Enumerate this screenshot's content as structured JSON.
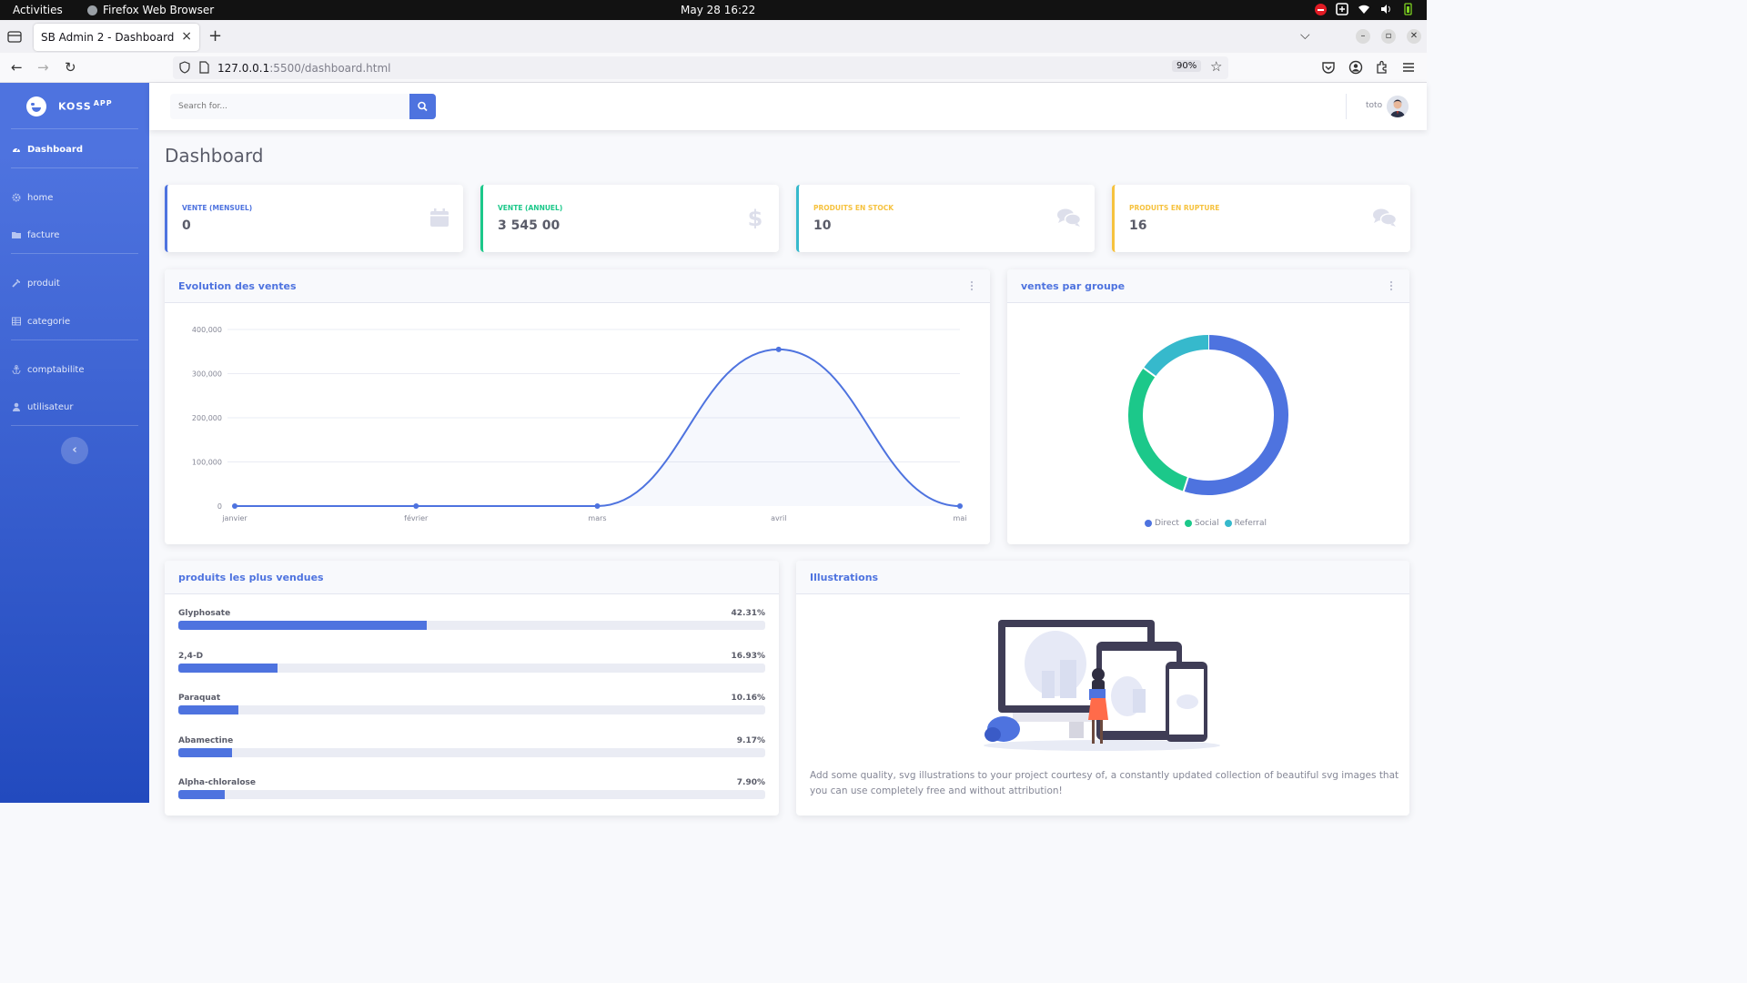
{
  "os": {
    "activities": "Activities",
    "app_name": "Firefox Web Browser",
    "clock": "May 28  16:22"
  },
  "browser": {
    "tab_title": "SB Admin 2 - Dashboard",
    "url_host": "127.0.0.1",
    "url_rest": ":5500/dashboard.html",
    "zoom": "90%"
  },
  "sidebar": {
    "brand": "KOSS",
    "brand_sup": "APP",
    "items": [
      {
        "label": "Dashboard",
        "icon": "dashboard-icon"
      },
      {
        "label": "home",
        "icon": "cog-icon"
      },
      {
        "label": "facture",
        "icon": "folder-icon"
      },
      {
        "label": "produit",
        "icon": "wrench-icon"
      },
      {
        "label": "categorie",
        "icon": "table-icon"
      },
      {
        "label": "comptabilite",
        "icon": "anchor-icon"
      },
      {
        "label": "utilisateur",
        "icon": "user-icon"
      }
    ]
  },
  "topbar": {
    "search_placeholder": "Search for...",
    "user_name": "toto"
  },
  "page": {
    "title": "Dashboard"
  },
  "stats": [
    {
      "label": "VENTE (MENSUEL)",
      "value": "0",
      "color": "#4e73df",
      "icon": "calendar-icon"
    },
    {
      "label": "VENTE (ANNUEL)",
      "value": "3 545 00",
      "color": "#1cc88a",
      "icon": "dollar-icon"
    },
    {
      "label": "PRODUITS EN STOCK",
      "value": "10",
      "color": "#f6c23e",
      "icon": "comments-icon"
    },
    {
      "label": "PRODUITS EN RUPTURE",
      "value": "16",
      "color": "#f6c23e",
      "icon": "comments-icon"
    }
  ],
  "area_card": {
    "title": "Evolution des ventes"
  },
  "pie_card": {
    "title": "ventes par groupe"
  },
  "products_card": {
    "title": "produits les plus vendues",
    "items": [
      {
        "name": "Glyphosate",
        "pct": "42.31%",
        "value": 42.31
      },
      {
        "name": "2,4-D",
        "pct": "16.93%",
        "value": 16.93
      },
      {
        "name": "Paraquat",
        "pct": "10.16%",
        "value": 10.16
      },
      {
        "name": "Abamectine",
        "pct": "9.17%",
        "value": 9.17
      },
      {
        "name": "Alpha-chloralose",
        "pct": "7.90%",
        "value": 7.9
      }
    ]
  },
  "illustrations_card": {
    "title": "Illustrations",
    "text": "Add some quality, svg illustrations to your project courtesy of, a constantly updated collection of beautiful svg images that you can use completely free and without attribution!"
  },
  "chart_data": [
    {
      "type": "area",
      "categories": [
        "janvier",
        "février",
        "mars",
        "avril",
        "mai"
      ],
      "values": [
        0,
        0,
        0,
        355000,
        0
      ],
      "ylim": [
        0,
        400000
      ],
      "yticks": [
        "0",
        "100,000",
        "200,000",
        "300,000",
        "400,000"
      ],
      "grid": true,
      "color": "#4e73df"
    },
    {
      "type": "pie",
      "donut": true,
      "labels": [
        "Direct",
        "Social",
        "Referral"
      ],
      "values": [
        55,
        30,
        15
      ],
      "colors": [
        "#4e73df",
        "#1cc88a",
        "#36b9cc"
      ],
      "legend": "bottom"
    }
  ]
}
